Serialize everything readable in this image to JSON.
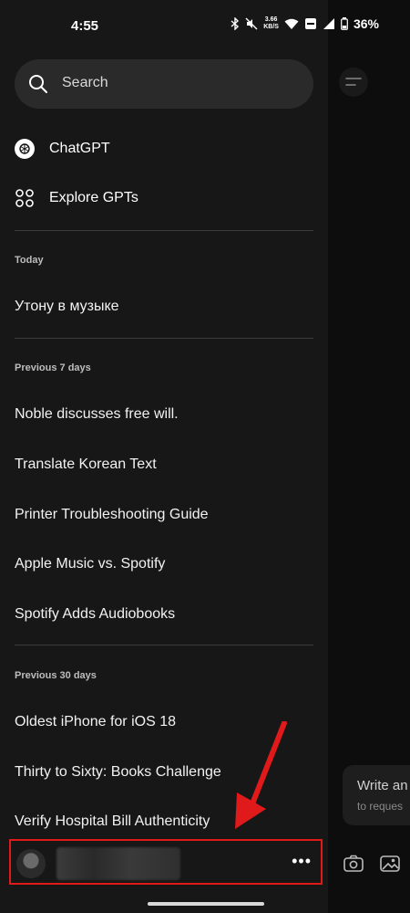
{
  "status_bar": {
    "time": "4:55",
    "net_speed_value": "3.66",
    "net_speed_unit": "KB/S",
    "battery_percent": "36%"
  },
  "drawer": {
    "search_label": "Search",
    "nav": [
      {
        "label": "ChatGPT",
        "icon": "chatgpt-logo-icon"
      },
      {
        "label": "Explore GPTs",
        "icon": "grid-icon"
      }
    ],
    "sections": [
      {
        "title": "Today",
        "chats": [
          "Утону в музыке"
        ]
      },
      {
        "title": "Previous 7 days",
        "chats": [
          "Noble discusses free will.",
          "Translate Korean Text",
          "Printer Troubleshooting Guide",
          "Apple Music vs. Spotify",
          "Spotify Adds Audiobooks"
        ]
      },
      {
        "title": "Previous 30 days",
        "chats": [
          "Oldest iPhone for iOS 18",
          "Thirty to Sixty: Books Challenge",
          "Verify Hospital Bill Authenticity"
        ]
      }
    ],
    "profile": {
      "more_label": "•••"
    }
  },
  "main": {
    "composer_title": "Write an",
    "composer_sub": "to reques"
  },
  "colors": {
    "highlight_red": "#e01a1a"
  }
}
